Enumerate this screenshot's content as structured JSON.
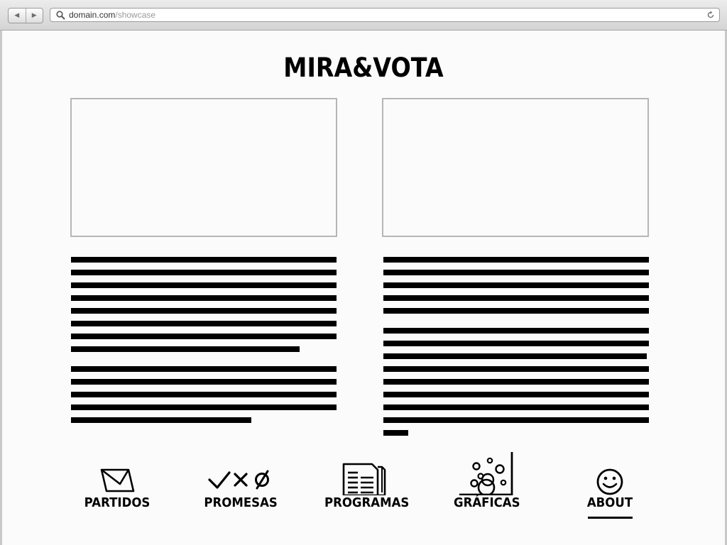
{
  "browser": {
    "url_host": "domain.com",
    "url_path": "/showcase",
    "icons": {
      "back": "back-arrow-icon",
      "forward": "forward-arrow-icon",
      "search": "search-icon",
      "reload": "reload-icon"
    }
  },
  "site": {
    "logo": "MIRA&VOTA"
  },
  "nav": [
    {
      "label": "PARTIDOS",
      "icon": "envelope-icon"
    },
    {
      "label": "PROMESAS",
      "icon": "check-cross-null-icon"
    },
    {
      "label": "PROGRAMAS",
      "icon": "documents-icon"
    },
    {
      "label": "GRÁFICAS",
      "icon": "bubble-chart-icon"
    },
    {
      "label": "ABOUT",
      "icon": "smiley-icon",
      "active": true
    }
  ],
  "colors": {
    "text": "#000000",
    "placeholder_border": "#b6b6b6",
    "background": "#fbfbfb"
  }
}
